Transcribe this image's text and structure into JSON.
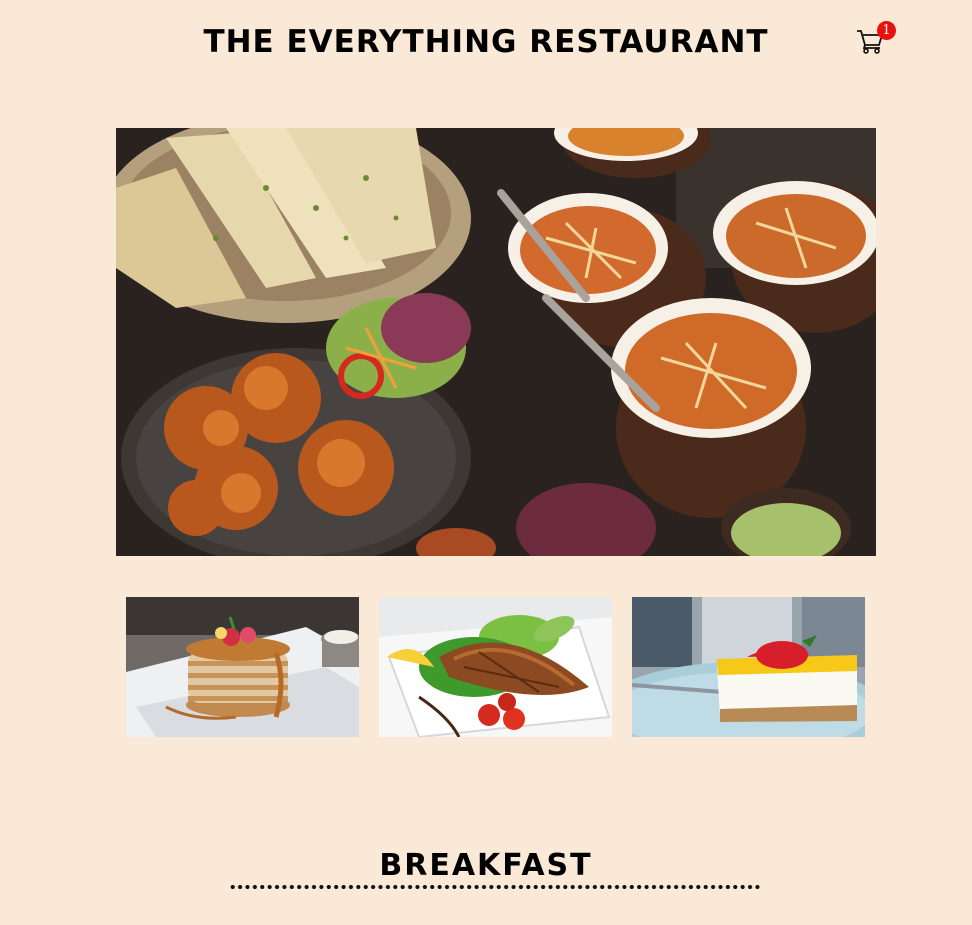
{
  "header": {
    "title": "THE EVERYTHING RESTAURANT",
    "cart_count": "1",
    "cart_icon": "shopping-cart-icon",
    "badge_color": "#e8110e"
  },
  "hero": {
    "image": "indian-food-spread-photo"
  },
  "thumbnails": [
    {
      "image": "pancakes-photo"
    },
    {
      "image": "grilled-salmon-salad-photo"
    },
    {
      "image": "cheesecake-photo"
    }
  ],
  "menu": {
    "section_title": "BREAKFAST"
  },
  "colors": {
    "background": "#fae9d7",
    "text": "#000000"
  }
}
